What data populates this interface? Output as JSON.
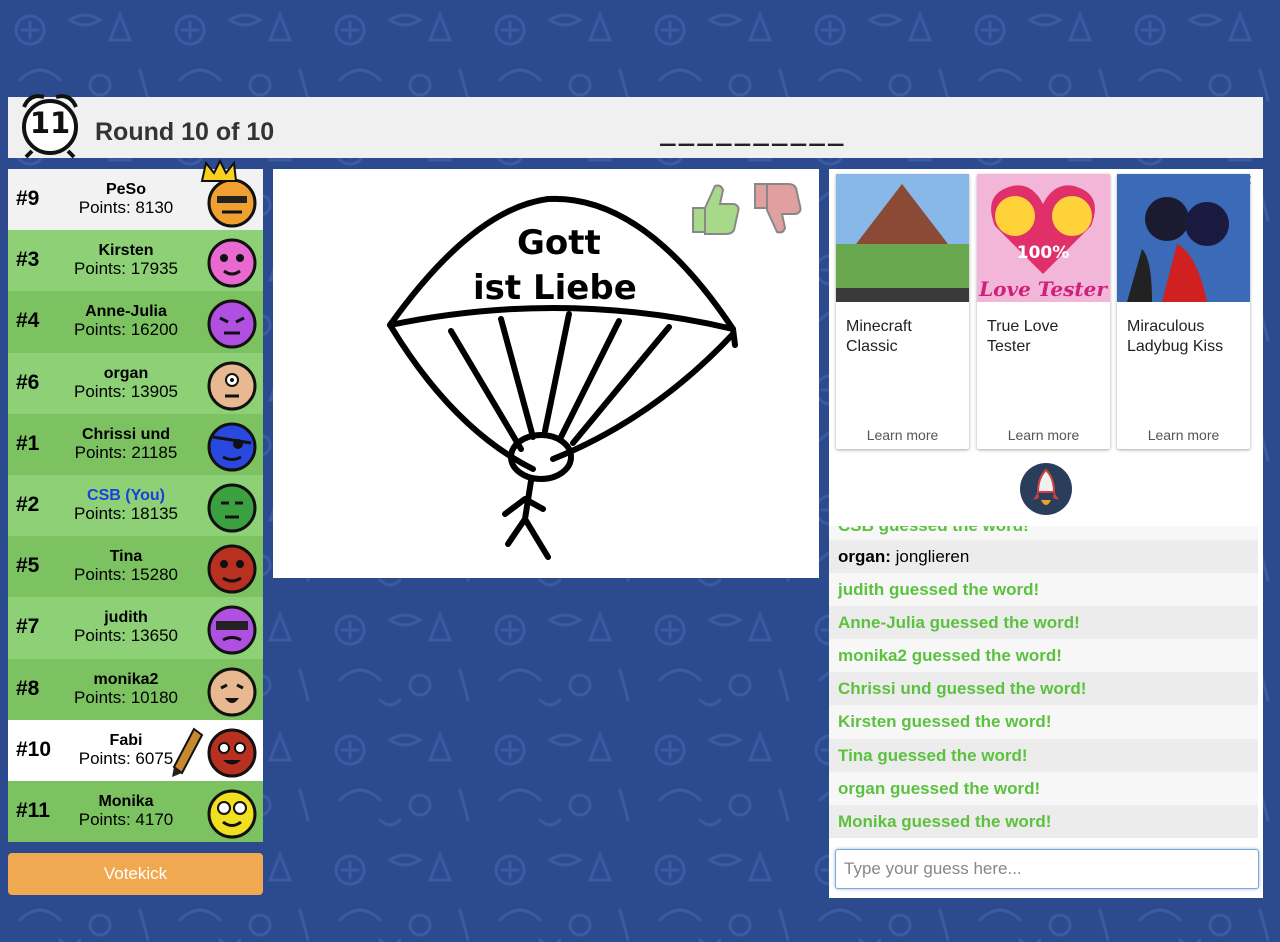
{
  "header": {
    "timer": "11",
    "round_text": "Round 10 of 10",
    "word_hint": "__________"
  },
  "players": [
    {
      "rank": "#9",
      "name": "PeSo",
      "points": "Points: 8130",
      "avatar_color": "#f0a030",
      "crown": true
    },
    {
      "rank": "#3",
      "name": "Kirsten",
      "points": "Points: 17935",
      "avatar_color": "#e86ad0"
    },
    {
      "rank": "#4",
      "name": "Anne-Julia",
      "points": "Points: 16200",
      "avatar_color": "#b050e0"
    },
    {
      "rank": "#6",
      "name": "organ",
      "points": "Points: 13905",
      "avatar_color": "#e8b890"
    },
    {
      "rank": "#1",
      "name": "Chrissi und",
      "points": "Points: 21185",
      "avatar_color": "#2848e0"
    },
    {
      "rank": "#2",
      "name": "CSB (You)",
      "points": "Points: 18135",
      "avatar_color": "#3aa040",
      "you": true
    },
    {
      "rank": "#5",
      "name": "Tina",
      "points": "Points: 15280",
      "avatar_color": "#b83020"
    },
    {
      "rank": "#7",
      "name": "judith",
      "points": "Points: 13650",
      "avatar_color": "#b050e0"
    },
    {
      "rank": "#8",
      "name": "monika2",
      "points": "Points: 10180",
      "avatar_color": "#e8b890"
    },
    {
      "rank": "#10",
      "name": "Fabi",
      "points": "Points: 6075",
      "avatar_color": "#b83020",
      "drawing": true
    },
    {
      "rank": "#11",
      "name": "Monika",
      "points": "Points: 4170",
      "avatar_color": "#f0e020"
    }
  ],
  "votekick_label": "Votekick",
  "canvas": {
    "drawing_text_line1": "Gott",
    "drawing_text_line2": "ist Liebe",
    "thumbs_up_color": "#a8d88a",
    "thumbs_down_color": "#e0a0a0"
  },
  "ad": {
    "cards": [
      {
        "title": "Minecraft Classic",
        "learn": "Learn more"
      },
      {
        "title": "True Love Tester",
        "learn": "Learn more",
        "badge": "100%",
        "logo": "Love Tester"
      },
      {
        "title": "Miraculous Ladybug Kiss",
        "learn": "Learn more"
      }
    ]
  },
  "chat": {
    "partial": "CSB guessed the word!",
    "messages": [
      {
        "sender": "organ:",
        "text": "jonglieren",
        "type": "normal"
      },
      {
        "text": "judith guessed the word!",
        "type": "green"
      },
      {
        "text": "Anne-Julia guessed the word!",
        "type": "green"
      },
      {
        "text": "monika2 guessed the word!",
        "type": "green"
      },
      {
        "text": "Chrissi und guessed the word!",
        "type": "green"
      },
      {
        "text": "Kirsten guessed the word!",
        "type": "green"
      },
      {
        "text": "Tina guessed the word!",
        "type": "green"
      },
      {
        "text": "organ guessed the word!",
        "type": "green"
      },
      {
        "text": "Monika guessed the word!",
        "type": "green"
      }
    ],
    "input_placeholder": "Type your guess here..."
  },
  "colors": {
    "background": "#2c4a8e",
    "player_green": "#8dd075",
    "guess_green": "#5cc13f",
    "votekick": "#f0a950",
    "you": "#1a3fe0"
  }
}
